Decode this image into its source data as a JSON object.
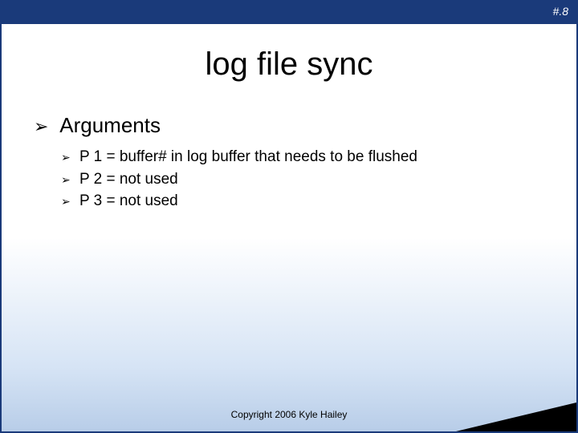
{
  "slide": {
    "number": "#.8",
    "title": "log file sync",
    "section_heading": "Arguments",
    "items": [
      "P 1 = buffer# in log buffer that needs to be flushed",
      "P 2 = not used",
      "P 3 = not used"
    ],
    "copyright": "Copyright 2006 Kyle Hailey"
  }
}
